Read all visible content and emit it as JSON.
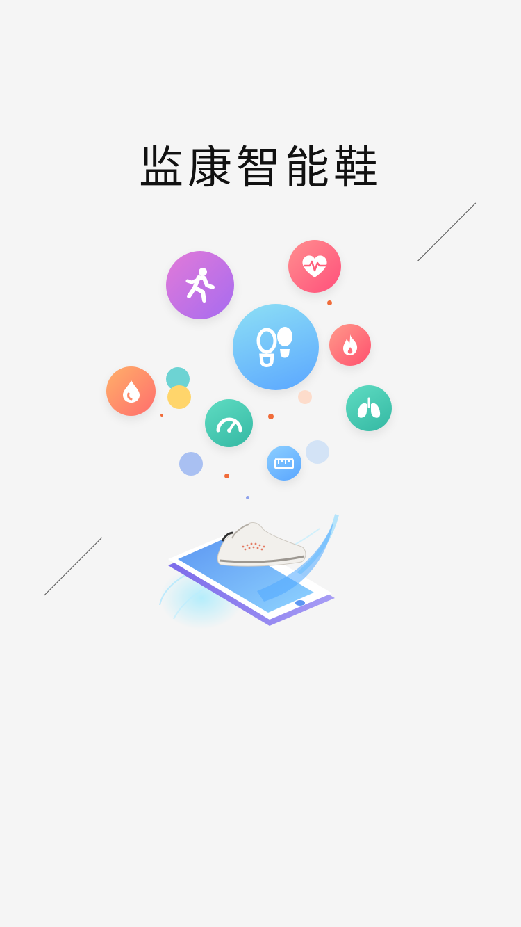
{
  "title": "监康智能鞋",
  "icons": {
    "walking": "walking-icon",
    "heart_rate": "heart-rate-icon",
    "footprints": "footprints-icon",
    "calories": "flame-icon",
    "blood": "blood-drop-icon",
    "speed": "speedometer-icon",
    "lungs": "lungs-icon",
    "ruler": "ruler-icon",
    "device": "smart-shoe-phone-illustration"
  },
  "colors": {
    "background": "#f5f5f5",
    "title": "#111111",
    "purple": "#b86be8",
    "pink": "#ff5f7a",
    "blue": "#6bb7ff",
    "orange": "#ff7a5c",
    "teal": "#49c9b0",
    "light_blue": "#62b7ff"
  }
}
